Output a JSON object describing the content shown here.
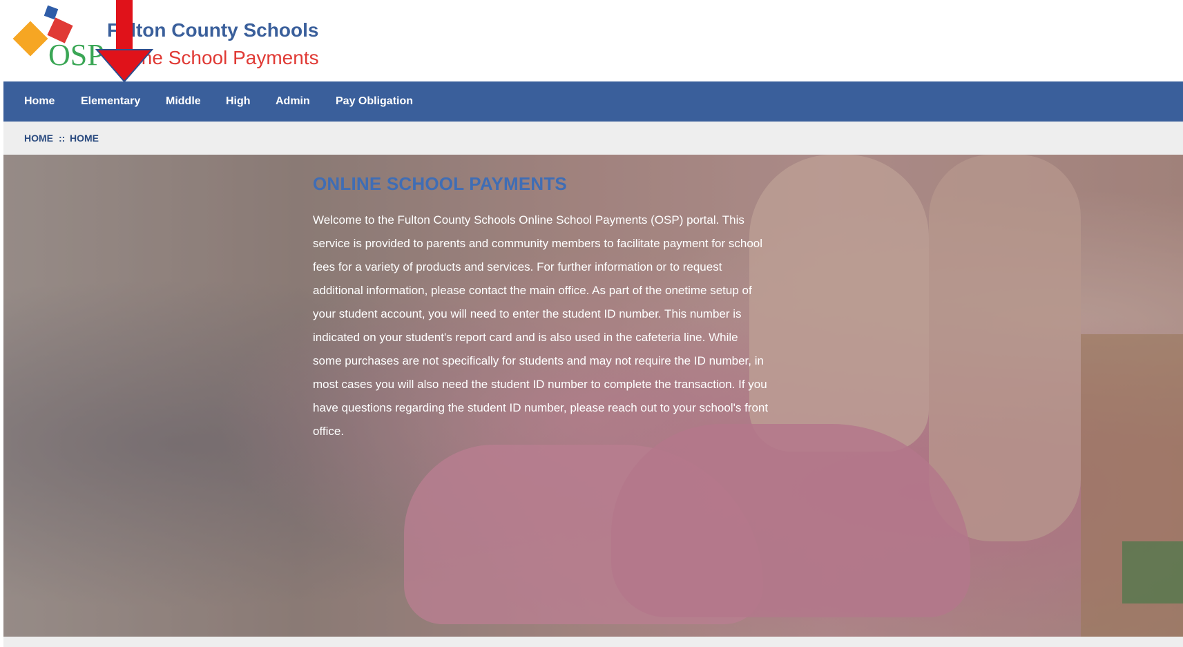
{
  "brand": {
    "logo_text": "OSP",
    "title": "Fulton County Schools",
    "subtitle": "Online School Payments"
  },
  "nav": {
    "items": [
      "Home",
      "Elementary",
      "Middle",
      "High",
      "Admin",
      "Pay Obligation"
    ]
  },
  "breadcrumb": {
    "parts": [
      "HOME",
      "::",
      "HOME"
    ]
  },
  "hero": {
    "title": "ONLINE SCHOOL PAYMENTS",
    "text": "Welcome to the Fulton County Schools Online School Payments (OSP) portal. This service is provided to parents and community members to facilitate payment for school fees for a variety of products and services. For further information or to request additional information, please contact the main office. As part of the onetime setup of your student account, you will need to enter the student ID number. This number is indicated on your student's report card and is also used in the cafeteria line. While some purchases are not specifically for students and may not require the ID number, in most cases you will also need the student ID number to complete the transaction. If you have questions regarding the student ID number, please reach out to your school's front office."
  },
  "colors": {
    "nav_background": "#3a5f9b",
    "title_blue": "#3f6db5",
    "brand_red": "#e03a35",
    "annotation_arrow": "#e0121a"
  }
}
